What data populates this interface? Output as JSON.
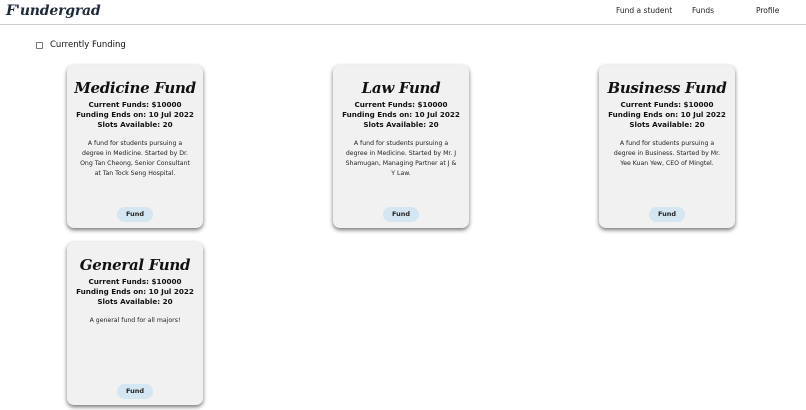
{
  "app": {
    "brand": "F'undergrad"
  },
  "nav": {
    "fund_a_student": "Fund a student",
    "funds": "Funds",
    "profile": "Profile"
  },
  "filter": {
    "label": "Currently Funding",
    "checked": false
  },
  "cards": [
    {
      "title": "Medicine Fund",
      "current_funds": "Current Funds: $10000",
      "funding_ends": "Funding Ends on: 10 Jul 2022",
      "slots": "Slots Available: 20",
      "description": "A fund for students pursuing a degree in Medicine. Started by Dr. Ong Tan Cheong, Senior Consultant at Tan Tock Seng Hospital.",
      "button_label": "Fund"
    },
    {
      "title": "Law Fund",
      "current_funds": "Current Funds: $10000",
      "funding_ends": "Funding Ends on: 10 Jul 2022",
      "slots": "Slots Available: 20",
      "description": "A fund for students pursuing a degree in Medicine. Started by Mr. J Shamugan, Managing Partner at J & Y Law.",
      "button_label": "Fund"
    },
    {
      "title": "Business Fund",
      "current_funds": "Current Funds: $10000",
      "funding_ends": "Funding Ends on: 10 Jul 2022",
      "slots": "Slots Available: 20",
      "description": "A fund for students pursuing a degree in Business. Started by Mr. Yee Kuan Yew, CEO of Mingtel.",
      "button_label": "Fund"
    },
    {
      "title": "General Fund",
      "current_funds": "Current Funds: $10000",
      "funding_ends": "Funding Ends on: 10 Jul 2022",
      "slots": "Slots Available: 20",
      "description": "A general fund for all majors!",
      "button_label": "Fund"
    }
  ],
  "colors": {
    "card_bg": "#f1f1f1",
    "button_bg": "#d4e6f1",
    "brand_text": "#1f2a3a"
  }
}
